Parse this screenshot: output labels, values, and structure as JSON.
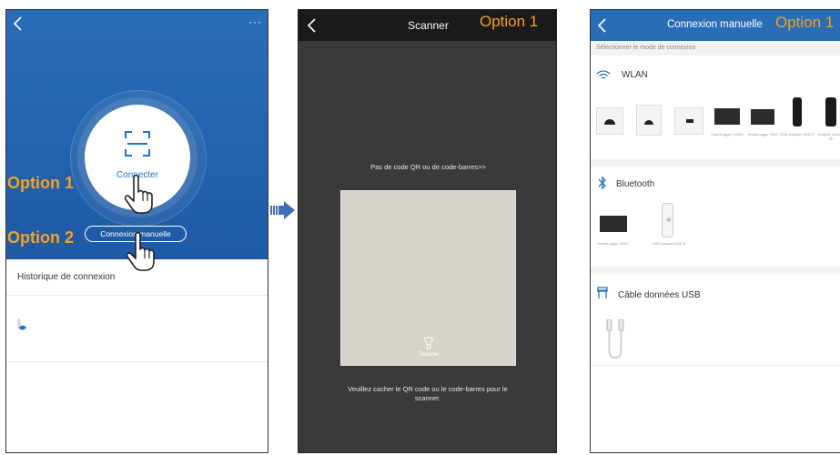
{
  "screen1": {
    "connect_label": "Connecter",
    "manual_button": "Connexion manuelle",
    "history_title": "Historique de connexion",
    "option1": "Option 1",
    "option2": "Option 2"
  },
  "screen2": {
    "title": "Scanner",
    "option_label": "Option 1",
    "no_code_link": "Pas de code QR ou de code-barres>>",
    "flash_label": "Toucher",
    "instructions": "Veuillez cacher le QR code ou le code-barres pour le scanner."
  },
  "screen3": {
    "title": "Connexion manuelle",
    "option_label": "Option 1",
    "subtitle": "Sélectionner le mode de connexion",
    "wlan_title": "WLAN",
    "wlan_captions": [
      "SmartLogger 1000A",
      "SmartLogger 3000",
      "USB-Adapter 2000-C",
      "Adapter WLAN-FE"
    ],
    "bluetooth_title": "Bluetooth",
    "bt_captions": [
      "SmartLogger 2000",
      "USB-Adapter2000-B"
    ],
    "usb_title": "Câble données USB"
  },
  "colors": {
    "blue": "#2a6db7",
    "orange": "#f5a21c",
    "link_blue": "#1f74c6"
  }
}
